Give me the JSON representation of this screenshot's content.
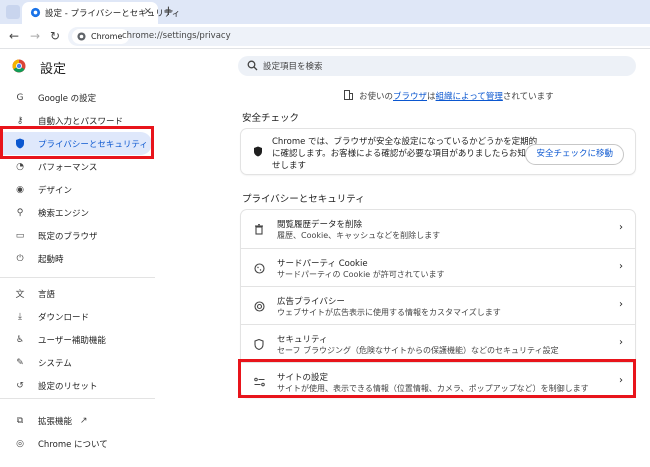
{
  "browser": {
    "tab_title": "設定 - プライバシーとセキュリティ",
    "tab_close": "×",
    "new_tab": "+",
    "chip_label": "Chrome",
    "url": "chrome://settings/privacy"
  },
  "page": {
    "title": "設定",
    "search_placeholder": "設定項目を検索",
    "managed_prefix": "お使いの",
    "managed_link1": "ブラウザ",
    "managed_mid": "は",
    "managed_link2": "組織によって管理",
    "managed_suffix": "されています"
  },
  "sidebar": {
    "items": [
      {
        "label": "Google の設定",
        "icon": "google-g-icon"
      },
      {
        "label": "自動入力とパスワード",
        "icon": "key-icon"
      },
      {
        "label": "プライバシーとセキュリティ",
        "icon": "shield-icon"
      },
      {
        "label": "パフォーマンス",
        "icon": "speedometer-icon"
      },
      {
        "label": "デザイン",
        "icon": "palette-icon"
      },
      {
        "label": "検索エンジン",
        "icon": "search-icon"
      },
      {
        "label": "既定のブラウザ",
        "icon": "browser-window-icon"
      },
      {
        "label": "起動時",
        "icon": "power-icon"
      },
      {
        "label": "言語",
        "icon": "translate-icon"
      },
      {
        "label": "ダウンロード",
        "icon": "download-icon"
      },
      {
        "label": "ユーザー補助機能",
        "icon": "accessibility-icon"
      },
      {
        "label": "システム",
        "icon": "wrench-icon"
      },
      {
        "label": "設定のリセット",
        "icon": "reset-icon"
      },
      {
        "label": "拡張機能",
        "icon": "puzzle-icon"
      },
      {
        "label": "Chrome について",
        "icon": "chrome-icon"
      }
    ]
  },
  "safety_check": {
    "heading": "安全チェック",
    "description": "Chrome では、ブラウザが安全な設定になっているかどうかを定期的に確認します。お客様による確認が必要な項目がありましたらお知らせします",
    "button": "安全チェックに移動"
  },
  "privacy": {
    "heading": "プライバシーとセキュリティ",
    "rows": [
      {
        "title": "閲覧履歴データを削除",
        "subtitle": "履歴、Cookie、キャッシュなどを削除します",
        "icon": "trash-icon"
      },
      {
        "title": "サードパーティ Cookie",
        "subtitle": "サードパーティの Cookie が許可されています",
        "icon": "cookie-icon"
      },
      {
        "title": "広告プライバシー",
        "subtitle": "ウェブサイトが広告表示に使用する情報をカスタマイズします",
        "icon": "ad-privacy-icon"
      },
      {
        "title": "セキュリティ",
        "subtitle": "セーフ ブラウジング（危険なサイトからの保護機能）などのセキュリティ設定",
        "icon": "security-icon"
      },
      {
        "title": "サイトの設定",
        "subtitle": "サイトが使用、表示できる情報（位置情報、カメラ、ポップアップなど）を制御します",
        "icon": "sliders-icon"
      }
    ],
    "chevron": "›"
  }
}
